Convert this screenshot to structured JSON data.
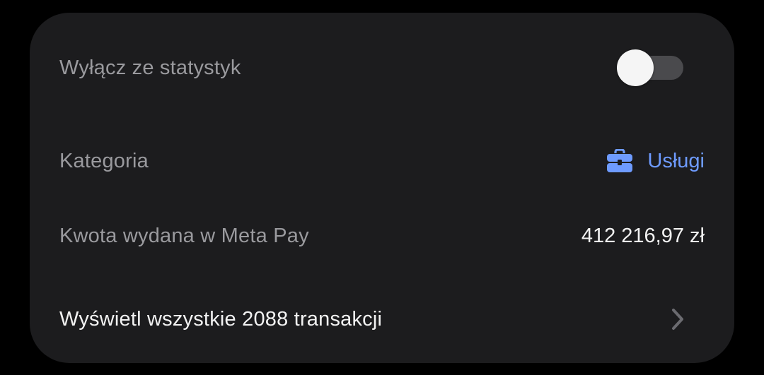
{
  "settings": {
    "exclude_stats": {
      "label": "Wyłącz ze statystyk",
      "enabled": false
    },
    "category": {
      "label": "Kategoria",
      "value": "Usługi",
      "icon": "briefcase-icon",
      "accent_color": "#6e9bff"
    },
    "amount": {
      "label": "Kwota wydana w Meta Pay",
      "value": "412 216,97 zł"
    },
    "transactions": {
      "label": "Wyświetl wszystkie 2088 transakcji",
      "icon": "chevron-right-icon"
    }
  }
}
